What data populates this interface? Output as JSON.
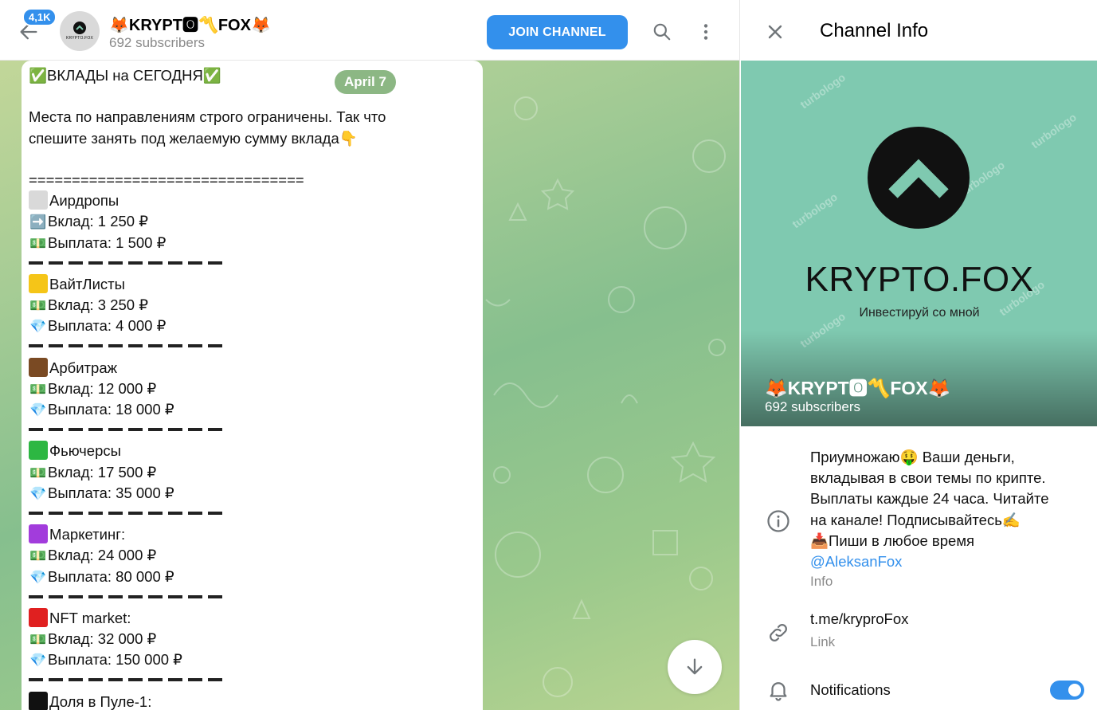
{
  "header": {
    "unread_count": "4,1K",
    "channel_title": "🦊KRYPT🅾〽️FOX🦊",
    "subscribers": "692 subscribers",
    "avatar_text": "KRYPTO.FOX",
    "join_label": "JOIN CHANNEL",
    "icons": [
      "back-arrow-icon",
      "search-icon",
      "more-vertical-icon"
    ]
  },
  "chat": {
    "date_label": "April 7",
    "message": {
      "headline": "✅ВКЛАДЫ на СЕГОДНЯ✅",
      "intro_line1": "Места по направлениям строго ограничены. Так что",
      "intro_line2": "спешите занять под желаемую сумму вклада👇",
      "separator": "================================",
      "sections": [
        {
          "name": "Аирдропы",
          "color": "#d9d9d9",
          "deposit": "Вклад: 1 250 ₽",
          "payout": "Выплата: 1 500 ₽",
          "deposit_icon": "➡️",
          "payout_icon": "💵"
        },
        {
          "name": "ВайтЛисты",
          "color": "#f5c518",
          "deposit": "Вклад: 3 250 ₽",
          "payout": "Выплата: 4 000 ₽",
          "deposit_icon": "💵",
          "payout_icon": "💎"
        },
        {
          "name": "Арбитраж",
          "color": "#7a4a23",
          "deposit": "Вклад: 12 000 ₽",
          "payout": "Выплата: 18 000 ₽",
          "deposit_icon": "💵",
          "payout_icon": "💎"
        },
        {
          "name": "Фьючерсы",
          "color": "#2db742",
          "deposit": "Вклад: 17 500 ₽",
          "payout": "Выплата: 35 000 ₽",
          "deposit_icon": "💵",
          "payout_icon": "💎"
        },
        {
          "name": "Маркетинг:",
          "color": "#a23cdc",
          "deposit": "Вклад: 24 000 ₽",
          "payout": "Выплата: 80 000 ₽",
          "deposit_icon": "💵",
          "payout_icon": "💎"
        },
        {
          "name": "NFT market:",
          "color": "#e02020",
          "deposit": "Вклад: 32 000 ₽",
          "payout": "Выплата: 150 000 ₽",
          "deposit_icon": "💵",
          "payout_icon": "💎"
        }
      ],
      "last_section": {
        "name": "Доля в Пуле-1:",
        "color": "#111111"
      }
    },
    "scroll_down_icon": "arrow-down-icon"
  },
  "info_panel": {
    "title": "Channel Info",
    "cover": {
      "brand": "KRYPTO.FOX",
      "tagline": "Инвестируй со мной",
      "watermark": "turbologo",
      "title": "🦊KRYPT🅾〽️FOX🦊",
      "subscribers": "692 subscribers"
    },
    "description": {
      "line1": "Приумножаю🤑 Ваши деньги,",
      "line2": "вкладывая в свои темы по крипте.",
      "line3": "Выплаты каждые 24 часа. Читайте",
      "line4": "на канале! Подписывайтесь✍️",
      "line5": "📥Пиши в любое время",
      "mention": "@AleksanFox",
      "caption": "Info"
    },
    "link": {
      "url": "t.me/kryproFox",
      "caption": "Link"
    },
    "notifications": {
      "label": "Notifications",
      "enabled": true
    },
    "colors": {
      "accent": "#3390ec",
      "cover_bg": "#7fc9b0"
    }
  }
}
